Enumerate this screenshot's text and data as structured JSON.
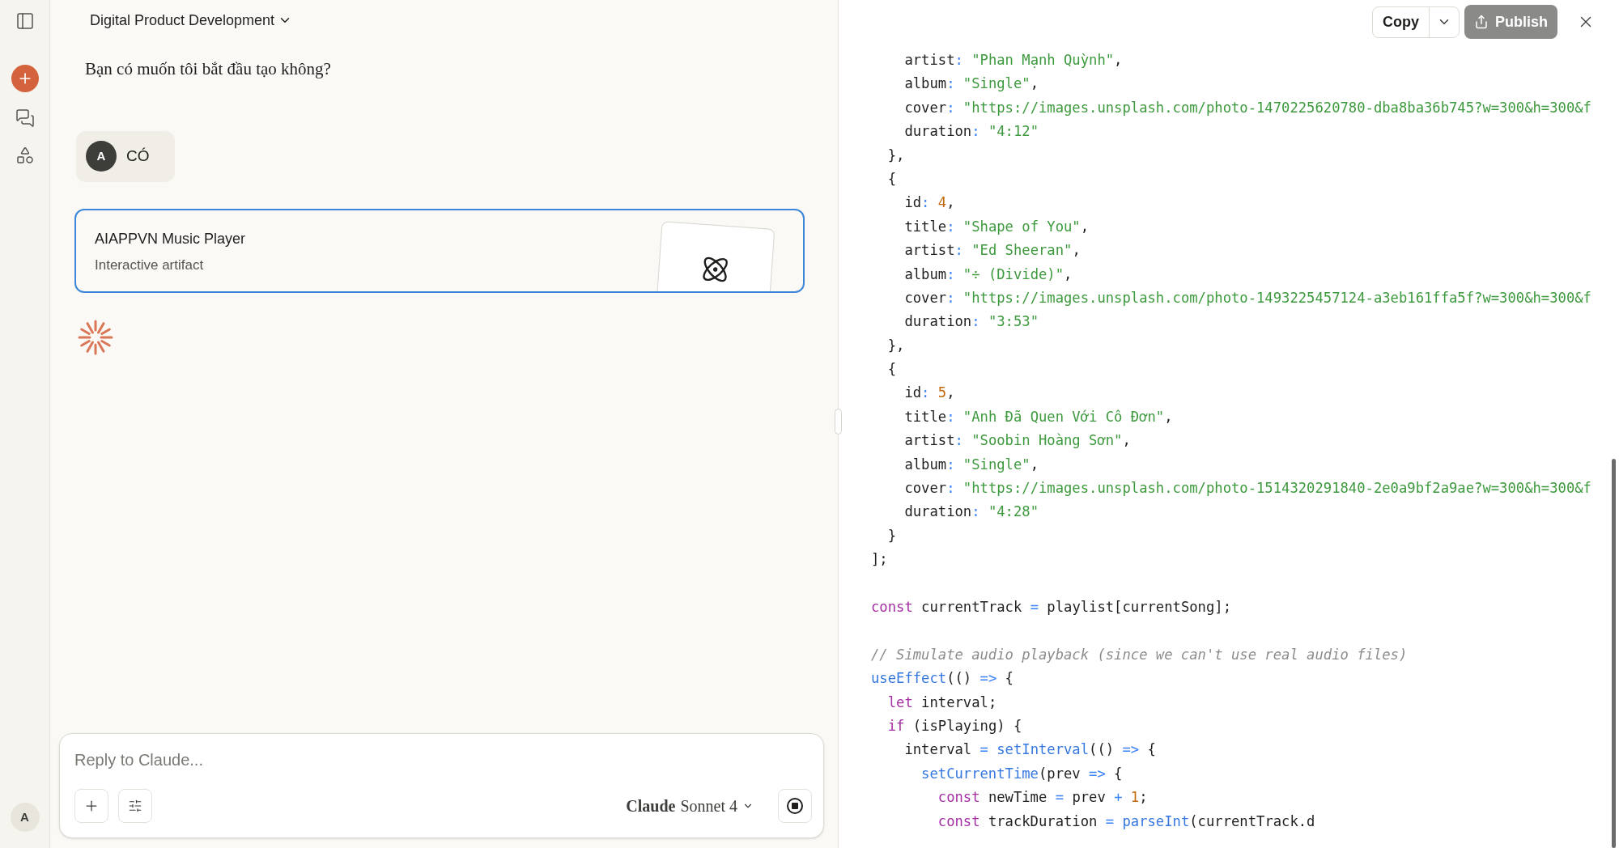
{
  "sidebar": {
    "avatar": "A"
  },
  "header": {
    "project": "Digital Product Development"
  },
  "messages": [
    {
      "kind": "assistant",
      "text": "Bạn có muốn tôi bắt đầu tạo không?"
    },
    {
      "kind": "user",
      "avatar": "A",
      "text": "CÓ"
    },
    {
      "kind": "artifact",
      "title": "AIAPPVN Music Player",
      "subtitle": "Interactive artifact"
    }
  ],
  "generating": true,
  "composer": {
    "placeholder": "Reply to Claude...",
    "model_family": "Claude",
    "model_name": "Sonnet 4"
  },
  "artifact_panel": {
    "copy": "Copy",
    "publish": "Publish",
    "code_lines": [
      {
        "kind": "code",
        "tokens": [
          {
            "kind": "plain",
            "text": "    artist"
          },
          {
            "kind": "op",
            "text": ":"
          },
          {
            "kind": "str",
            "text": " \"Phan Mạnh Quỳnh\""
          },
          {
            "kind": "plain",
            "text": ","
          }
        ]
      },
      {
        "kind": "code",
        "tokens": [
          {
            "kind": "plain",
            "text": "    album"
          },
          {
            "kind": "op",
            "text": ":"
          },
          {
            "kind": "str",
            "text": " \"Single\""
          },
          {
            "kind": "plain",
            "text": ","
          }
        ]
      },
      {
        "kind": "code",
        "tokens": [
          {
            "kind": "plain",
            "text": "    cover"
          },
          {
            "kind": "op",
            "text": ":"
          },
          {
            "kind": "str",
            "text": " \"https://images.unsplash.com/photo-1470225620780-dba8ba36b745?w=300&h=300&f"
          }
        ]
      },
      {
        "kind": "code",
        "tokens": [
          {
            "kind": "plain",
            "text": "    duration"
          },
          {
            "kind": "op",
            "text": ":"
          },
          {
            "kind": "str",
            "text": " \"4:12\""
          }
        ]
      },
      {
        "kind": "code",
        "tokens": [
          {
            "kind": "plain",
            "text": "  },"
          }
        ]
      },
      {
        "kind": "code",
        "tokens": [
          {
            "kind": "plain",
            "text": "  {"
          }
        ]
      },
      {
        "kind": "code",
        "tokens": [
          {
            "kind": "plain",
            "text": "    id"
          },
          {
            "kind": "op",
            "text": ":"
          },
          {
            "kind": "num",
            "text": " 4"
          },
          {
            "kind": "plain",
            "text": ","
          }
        ]
      },
      {
        "kind": "code",
        "tokens": [
          {
            "kind": "plain",
            "text": "    title"
          },
          {
            "kind": "op",
            "text": ":"
          },
          {
            "kind": "str",
            "text": " \"Shape of You\""
          },
          {
            "kind": "plain",
            "text": ","
          }
        ]
      },
      {
        "kind": "code",
        "tokens": [
          {
            "kind": "plain",
            "text": "    artist"
          },
          {
            "kind": "op",
            "text": ":"
          },
          {
            "kind": "str",
            "text": " \"Ed Sheeran\""
          },
          {
            "kind": "plain",
            "text": ","
          }
        ]
      },
      {
        "kind": "code",
        "tokens": [
          {
            "kind": "plain",
            "text": "    album"
          },
          {
            "kind": "op",
            "text": ":"
          },
          {
            "kind": "str",
            "text": " \"÷ (Divide)\""
          },
          {
            "kind": "plain",
            "text": ","
          }
        ]
      },
      {
        "kind": "code",
        "tokens": [
          {
            "kind": "plain",
            "text": "    cover"
          },
          {
            "kind": "op",
            "text": ":"
          },
          {
            "kind": "str",
            "text": " \"https://images.unsplash.com/photo-1493225457124-a3eb161ffa5f?w=300&h=300&f"
          }
        ]
      },
      {
        "kind": "code",
        "tokens": [
          {
            "kind": "plain",
            "text": "    duration"
          },
          {
            "kind": "op",
            "text": ":"
          },
          {
            "kind": "str",
            "text": " \"3:53\""
          }
        ]
      },
      {
        "kind": "code",
        "tokens": [
          {
            "kind": "plain",
            "text": "  },"
          }
        ]
      },
      {
        "kind": "code",
        "tokens": [
          {
            "kind": "plain",
            "text": "  {"
          }
        ]
      },
      {
        "kind": "code",
        "tokens": [
          {
            "kind": "plain",
            "text": "    id"
          },
          {
            "kind": "op",
            "text": ":"
          },
          {
            "kind": "num",
            "text": " 5"
          },
          {
            "kind": "plain",
            "text": ","
          }
        ]
      },
      {
        "kind": "code",
        "tokens": [
          {
            "kind": "plain",
            "text": "    title"
          },
          {
            "kind": "op",
            "text": ":"
          },
          {
            "kind": "str",
            "text": " \"Anh Đã Quen Với Cô Đơn\""
          },
          {
            "kind": "plain",
            "text": ","
          }
        ]
      },
      {
        "kind": "code",
        "tokens": [
          {
            "kind": "plain",
            "text": "    artist"
          },
          {
            "kind": "op",
            "text": ":"
          },
          {
            "kind": "str",
            "text": " \"Soobin Hoàng Sơn\""
          },
          {
            "kind": "plain",
            "text": ","
          }
        ]
      },
      {
        "kind": "code",
        "tokens": [
          {
            "kind": "plain",
            "text": "    album"
          },
          {
            "kind": "op",
            "text": ":"
          },
          {
            "kind": "str",
            "text": " \"Single\""
          },
          {
            "kind": "plain",
            "text": ","
          }
        ]
      },
      {
        "kind": "code",
        "tokens": [
          {
            "kind": "plain",
            "text": "    cover"
          },
          {
            "kind": "op",
            "text": ":"
          },
          {
            "kind": "str",
            "text": " \"https://images.unsplash.com/photo-1514320291840-2e0a9bf2a9ae?w=300&h=300&f"
          }
        ]
      },
      {
        "kind": "code",
        "tokens": [
          {
            "kind": "plain",
            "text": "    duration"
          },
          {
            "kind": "op",
            "text": ":"
          },
          {
            "kind": "str",
            "text": " \"4:28\""
          }
        ]
      },
      {
        "kind": "code",
        "tokens": [
          {
            "kind": "plain",
            "text": "  }"
          }
        ]
      },
      {
        "kind": "code",
        "tokens": [
          {
            "kind": "plain",
            "text": "];"
          }
        ]
      },
      {
        "kind": "blank"
      },
      {
        "kind": "code",
        "tokens": [
          {
            "kind": "kw",
            "text": "const"
          },
          {
            "kind": "plain",
            "text": " currentTrack "
          },
          {
            "kind": "op",
            "text": "="
          },
          {
            "kind": "plain",
            "text": " playlist[currentSong];"
          }
        ]
      },
      {
        "kind": "blank"
      },
      {
        "kind": "code",
        "tokens": [
          {
            "kind": "comment",
            "text": "// Simulate audio playback (since we can't use real audio files)"
          }
        ]
      },
      {
        "kind": "code",
        "tokens": [
          {
            "kind": "fn",
            "text": "useEffect"
          },
          {
            "kind": "plain",
            "text": "(() "
          },
          {
            "kind": "op",
            "text": "=>"
          },
          {
            "kind": "plain",
            "text": " {"
          }
        ]
      },
      {
        "kind": "code",
        "tokens": [
          {
            "kind": "kw",
            "text": "  let"
          },
          {
            "kind": "plain",
            "text": " interval;"
          }
        ]
      },
      {
        "kind": "code",
        "tokens": [
          {
            "kind": "kw",
            "text": "  if"
          },
          {
            "kind": "plain",
            "text": " (isPlaying) {"
          }
        ]
      },
      {
        "kind": "code",
        "tokens": [
          {
            "kind": "plain",
            "text": "    interval "
          },
          {
            "kind": "op",
            "text": "="
          },
          {
            "kind": "fn",
            "text": " setInterval"
          },
          {
            "kind": "plain",
            "text": "(() "
          },
          {
            "kind": "op",
            "text": "=>"
          },
          {
            "kind": "plain",
            "text": " {"
          }
        ]
      },
      {
        "kind": "code",
        "tokens": [
          {
            "kind": "fn",
            "text": "      setCurrentTime"
          },
          {
            "kind": "plain",
            "text": "(prev "
          },
          {
            "kind": "op",
            "text": "=>"
          },
          {
            "kind": "plain",
            "text": " {"
          }
        ]
      },
      {
        "kind": "code",
        "tokens": [
          {
            "kind": "kw",
            "text": "        const"
          },
          {
            "kind": "plain",
            "text": " newTime "
          },
          {
            "kind": "op",
            "text": "="
          },
          {
            "kind": "plain",
            "text": " prev "
          },
          {
            "kind": "op",
            "text": "+"
          },
          {
            "kind": "num",
            "text": " 1"
          },
          {
            "kind": "plain",
            "text": ";"
          }
        ]
      },
      {
        "kind": "code",
        "tokens": [
          {
            "kind": "kw",
            "text": "        const"
          },
          {
            "kind": "plain",
            "text": " trackDuration "
          },
          {
            "kind": "op",
            "text": "="
          },
          {
            "kind": "fn",
            "text": " parseInt"
          },
          {
            "kind": "plain",
            "text": "(currentTrack.d"
          }
        ]
      }
    ]
  }
}
